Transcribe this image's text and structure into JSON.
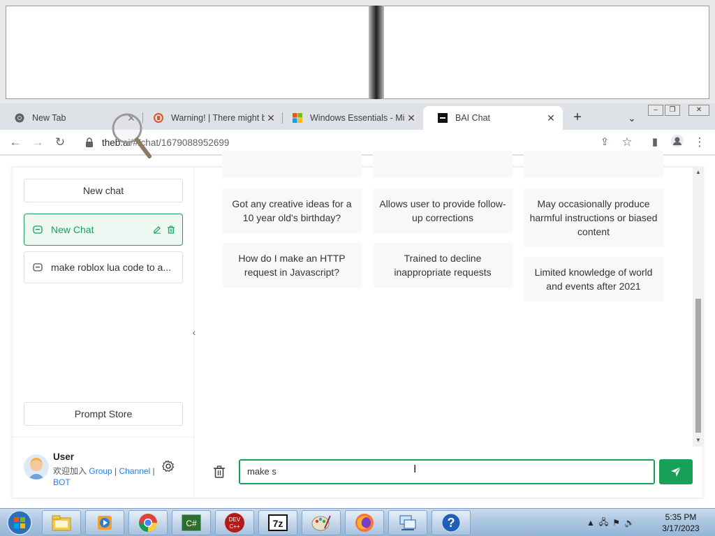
{
  "browser": {
    "tabs": [
      {
        "label": "New Tab",
        "favicon": "chrome-icon",
        "active": false
      },
      {
        "label": "Warning! | There might be",
        "favicon": "brave-warning-icon",
        "active": false
      },
      {
        "label": "Windows Essentials - Mic",
        "favicon": "microsoft-icon",
        "active": false
      },
      {
        "label": "BAI Chat",
        "favicon": "bai-icon",
        "active": true
      }
    ],
    "url_host": "theb.ai",
    "url_path": "/#/chat/1679088952699"
  },
  "sidebar": {
    "new_chat_label": "New chat",
    "chats": [
      {
        "label": "New Chat",
        "active": true
      },
      {
        "label": "make roblox lua code to a...",
        "active": false
      }
    ],
    "prompt_store_label": "Prompt Store",
    "user": {
      "name": "User",
      "join_prefix": "欢迎加入",
      "links": [
        "Group",
        "Channel",
        "BOT"
      ]
    }
  },
  "examples": {
    "col1": [
      "Got any creative ideas for a 10 year old's birthday?",
      "How do I make an HTTP request in Javascript?"
    ],
    "col2": [
      "Allows user to provide follow-up corrections",
      "Trained to decline inappropriate requests"
    ],
    "col3": [
      "May occasionally produce harmful instructions or biased content",
      "Limited knowledge of world and events after 2021"
    ]
  },
  "composer": {
    "input_value": "make s"
  },
  "taskbar": {
    "items": [
      "explorer-icon",
      "media-player-icon",
      "chrome-icon",
      "csharp-icon",
      "devcpp-icon",
      "7zip-icon",
      "paint-icon",
      "firefox-icon",
      "network-icon",
      "help-icon"
    ],
    "time": "5:35 PM",
    "date": "3/17/2023"
  },
  "colors": {
    "accent": "#18a058",
    "link": "#2080f0"
  }
}
